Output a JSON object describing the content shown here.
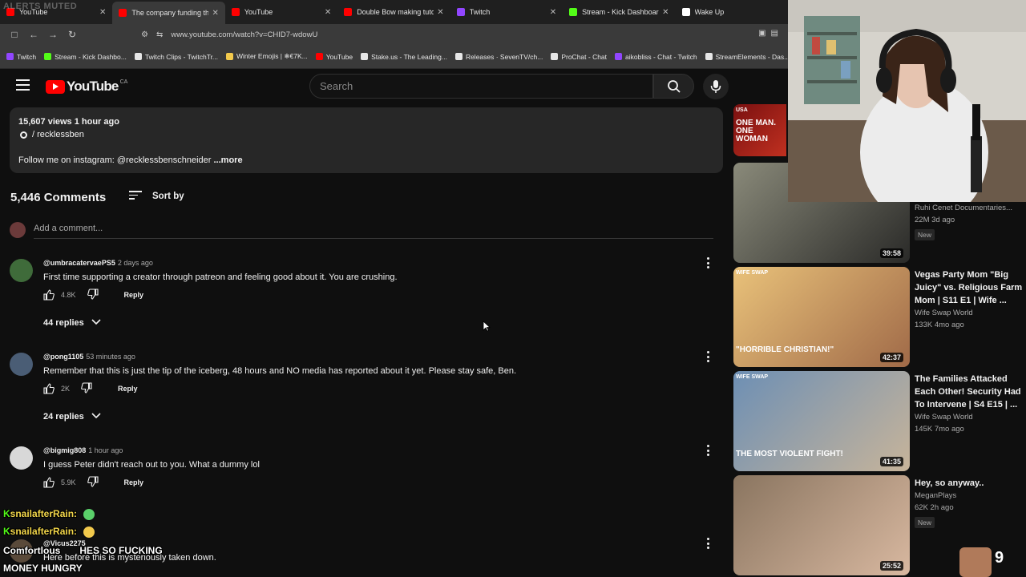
{
  "browser": {
    "alerts_overlay": "ALERTS MUTED",
    "tabs": [
      {
        "title": "YouTube",
        "favicon_color": "#ff0000",
        "active": false
      },
      {
        "title": "The company funding the world",
        "favicon_color": "#ff0000",
        "active": true
      },
      {
        "title": "YouTube",
        "favicon_color": "#ff0000",
        "active": false
      },
      {
        "title": "Double Bow making tutorial",
        "favicon_color": "#ff0000",
        "active": false
      },
      {
        "title": "Twitch",
        "favicon_color": "#9146ff",
        "active": false
      },
      {
        "title": "Stream - Kick Dashboard",
        "favicon_color": "#53fc18",
        "active": false
      },
      {
        "title": "Wake Up",
        "favicon_color": "#ffffff",
        "active": false
      }
    ],
    "url": "www.youtube.com/watch?v=CHID7-wdowU",
    "bookmarks": [
      {
        "label": "Twitch",
        "color": "#9146ff"
      },
      {
        "label": "Stream - Kick Dashbo...",
        "color": "#53fc18"
      },
      {
        "label": "Twitch Clips - TwitchTr...",
        "color": "#e6e6e6"
      },
      {
        "label": "Winter Emojis | ❄€7K...",
        "color": "#f2c94c"
      },
      {
        "label": "YouTube",
        "color": "#ff0000"
      },
      {
        "label": "Stake.us - The Leading...",
        "color": "#e6e6e6"
      },
      {
        "label": "Releases · SevenTV/ch...",
        "color": "#e6e6e6"
      },
      {
        "label": "ProChat - Chat",
        "color": "#e6e6e6"
      },
      {
        "label": "aikobliss - Chat - Twitch",
        "color": "#9146ff"
      },
      {
        "label": "StreamElements - Das...",
        "color": "#e6e6e6"
      }
    ]
  },
  "youtube": {
    "logo_text": "YouTube",
    "country": "CA",
    "search_placeholder": "Search"
  },
  "description": {
    "meta": "15,607 views  1 hour ago",
    "channel": "/ recklessben",
    "text": "Follow me on instagram: @recklessbenschneider",
    "more": "...more"
  },
  "comments": {
    "count_label": "5,446 Comments",
    "sort_label": "Sort by",
    "add_placeholder": "Add a comment...",
    "items": [
      {
        "user": "@umbracatervaePS5",
        "ago": "2 days ago",
        "text": "First time supporting a creator through patreon and feeling good about it. You are crushing.",
        "likes": "4.8K",
        "reply": "Reply",
        "replies": "44 replies",
        "avatar_color": "#3f6b3a"
      },
      {
        "user": "@pong1105",
        "ago": "53 minutes ago",
        "text": "Remember that this is just the tip of the iceberg, 48 hours and NO media has reported about it yet. Please stay safe, Ben.",
        "likes": "2K",
        "reply": "Reply",
        "replies": "24 replies",
        "avatar_color": "#4a5d75"
      },
      {
        "user": "@bigmig808",
        "ago": "1 hour ago",
        "text": "I guess Peter didn't reach out to you. What a dummy lol",
        "likes": "5.9K",
        "reply": "Reply",
        "replies": "",
        "avatar_color": "#d8d8d8"
      },
      {
        "user": "@Vicus2275",
        "ago": "",
        "text": "Here before this is mysteriously taken down.",
        "likes": "",
        "reply": "",
        "replies": "",
        "avatar_color": "#5a4a3a"
      }
    ]
  },
  "sidebar": {
    "videos": [
      {
        "thumb_caption": "ONE MAN. ONE WOMAN",
        "thumb_tag": "USA",
        "duration": "",
        "title": "",
        "channel": "",
        "stats": "",
        "badge": "",
        "colors": [
          "#7a1010",
          "#c03020"
        ]
      },
      {
        "thumb_caption": "",
        "thumb_tag": "",
        "duration": "39:58",
        "title": "",
        "channel": "Ruhi Cenet Documentaries...",
        "stats": "22M  3d ago",
        "badge": "New",
        "colors": [
          "#8a8a7a",
          "#2a2a28"
        ]
      },
      {
        "thumb_caption": "\"HORRIBLE CHRISTIAN!\"",
        "thumb_tag": "WIFE SWAP",
        "duration": "42:37",
        "title": "Vegas Party Mom \"Big Juicy\" vs. Religious Farm Mom | S11 E1 | Wife ...",
        "channel": "Wife Swap World",
        "stats": "133K  4mo ago",
        "badge": "",
        "colors": [
          "#e9c27a",
          "#a06a48"
        ]
      },
      {
        "thumb_caption": "THE MOST VIOLENT FIGHT!",
        "thumb_tag": "WIFE SWAP",
        "duration": "41:35",
        "title": "The Families Attacked Each Other! Security Had To Intervene | S4 E15 | ...",
        "channel": "Wife Swap World",
        "stats": "145K  7mo ago",
        "badge": "",
        "colors": [
          "#6d8fb4",
          "#c7b49a"
        ]
      },
      {
        "thumb_caption": "",
        "thumb_tag": "",
        "duration": "25:52",
        "title": "Hey, so anyway..",
        "channel": "MeganPlays",
        "stats": "62K  2h ago",
        "badge": "New",
        "colors": [
          "#8a7560",
          "#d8b8a0"
        ]
      }
    ]
  },
  "chat": {
    "lines": [
      {
        "user": "snailafterRain:",
        "text": ""
      },
      {
        "user": "snailafterRain:",
        "text": ""
      },
      {
        "user": "Comfortlous",
        "text": "HES SO FUCKING"
      },
      {
        "user": "",
        "text": "MONEY HUNGRY"
      }
    ]
  },
  "overlay": {
    "viewer_count": "9"
  }
}
